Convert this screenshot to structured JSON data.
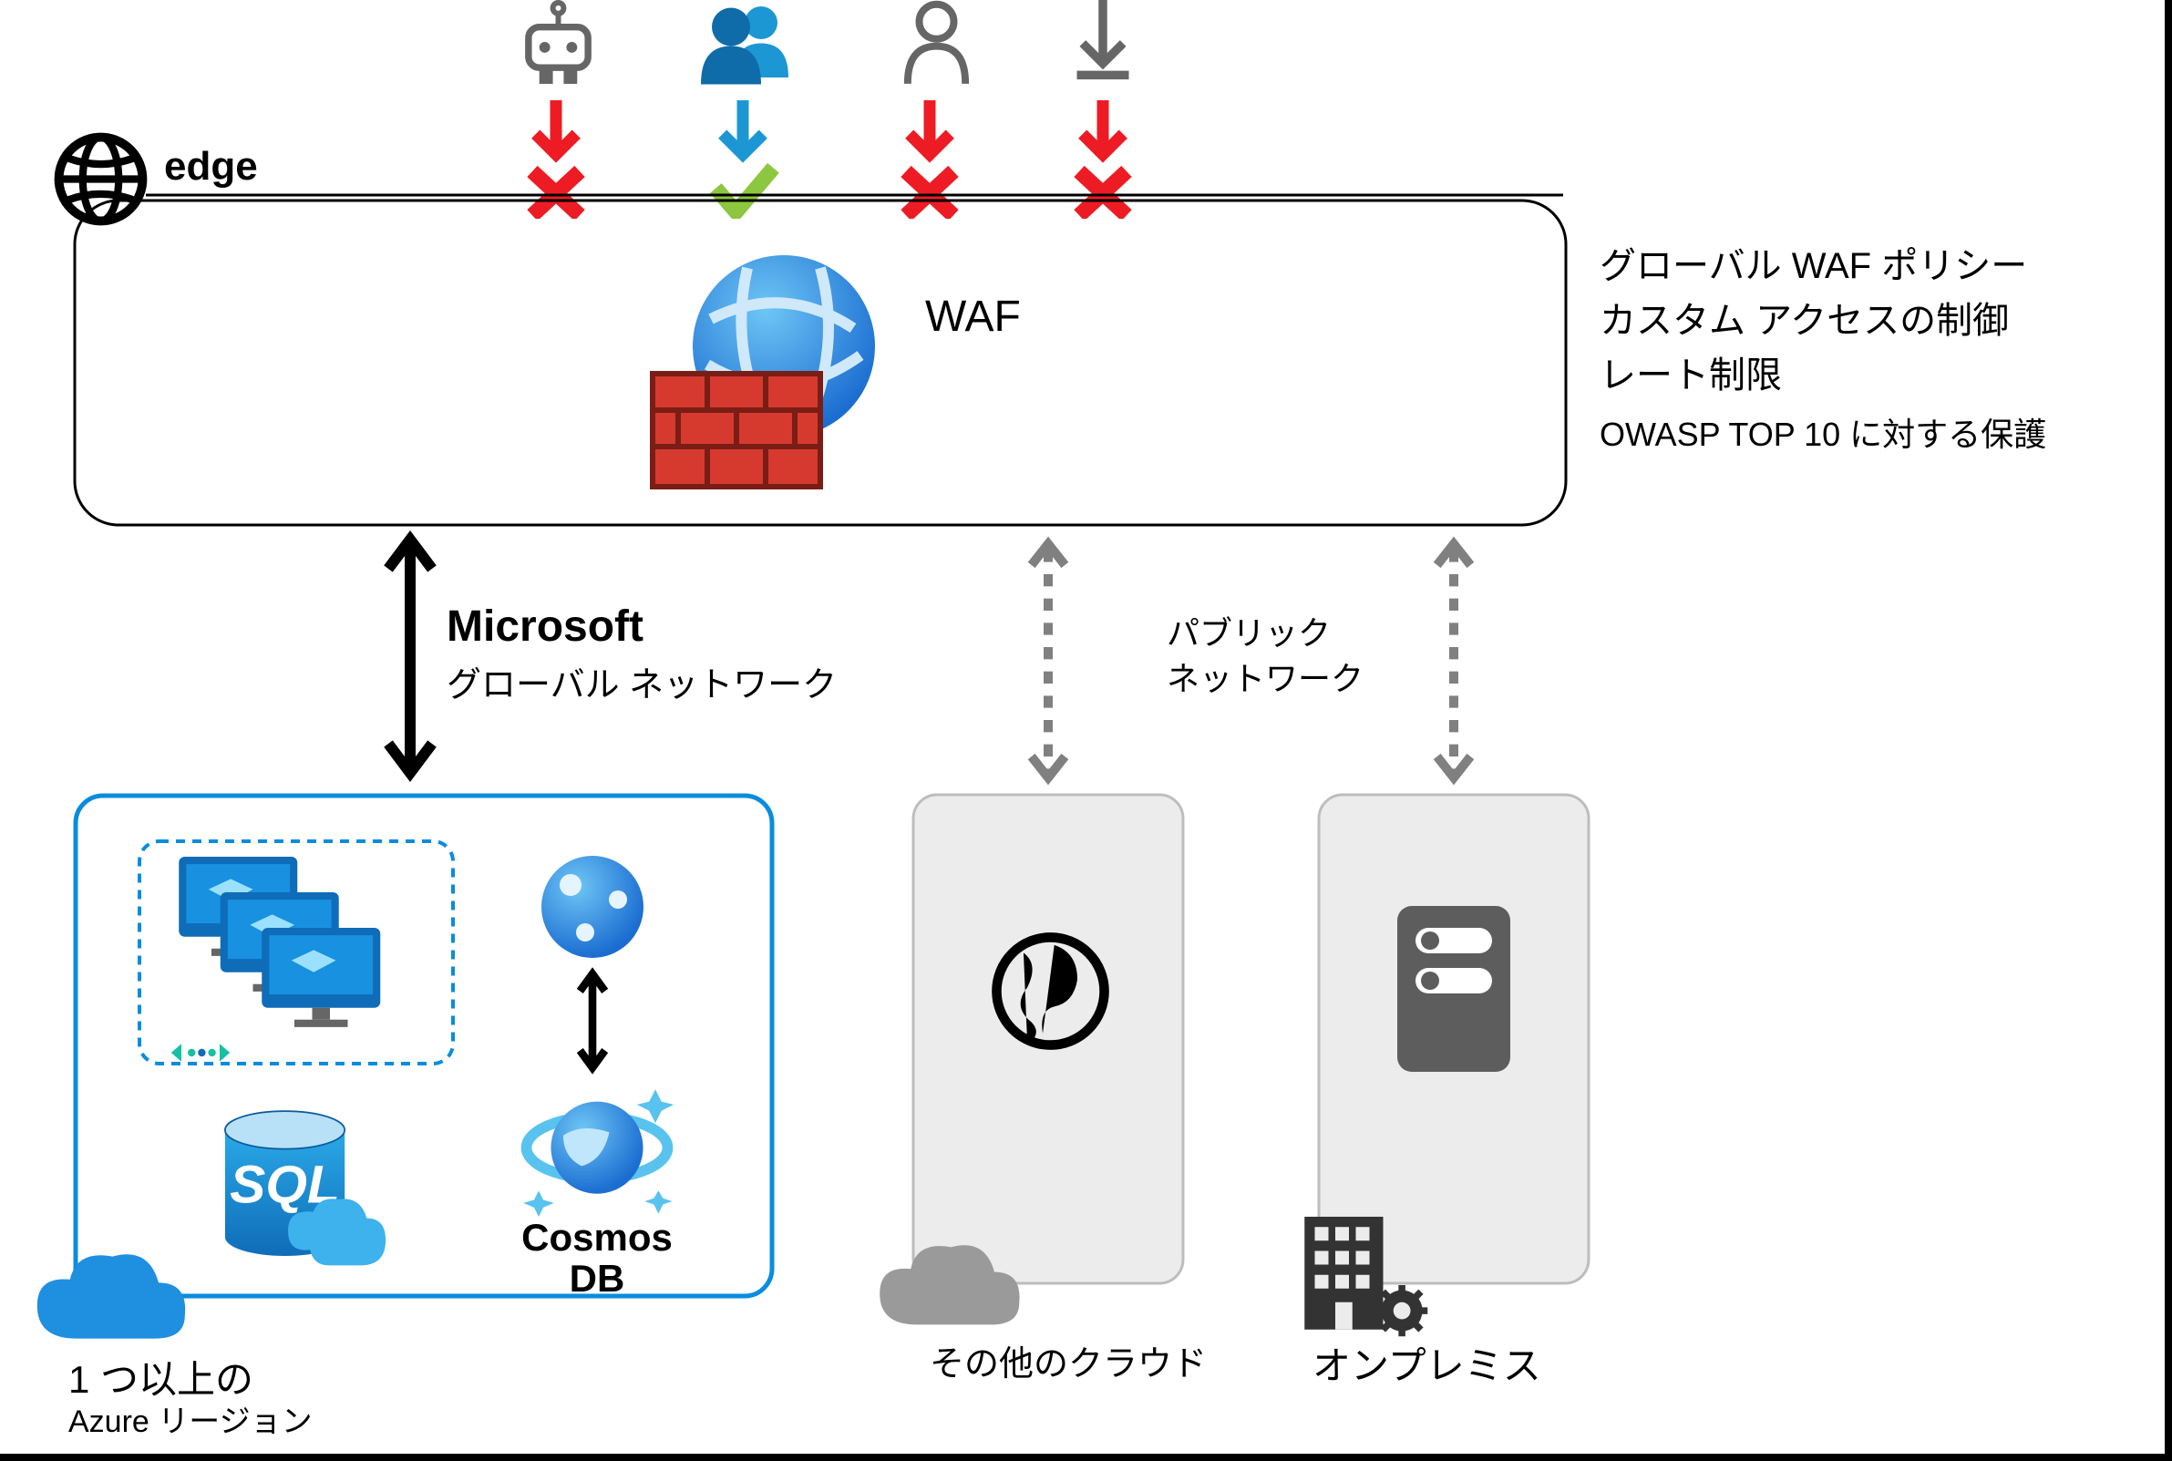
{
  "edge": {
    "label": "edge"
  },
  "waf": {
    "label": "WAF"
  },
  "features": {
    "line1": "グローバル WAF ポリシー",
    "line2": "カスタム アクセスの制御",
    "line3": "レート制限",
    "line4": "OWASP TOP 10 に対する保護"
  },
  "microsoft": {
    "title": "Microsoft",
    "subtitle": "グローバル ネットワーク"
  },
  "public_network": {
    "line1": "パブリック",
    "line2": "ネットワーク"
  },
  "cosmos": {
    "label1": "Cosmos",
    "label2": "DB"
  },
  "sql": {
    "label": "SQL"
  },
  "azure_region": {
    "line1": "1 つ以上の",
    "line2": "Azure リージョン"
  },
  "other_cloud": {
    "label": "その他のクラウド"
  },
  "on_premises": {
    "label": "オンプレミス"
  }
}
